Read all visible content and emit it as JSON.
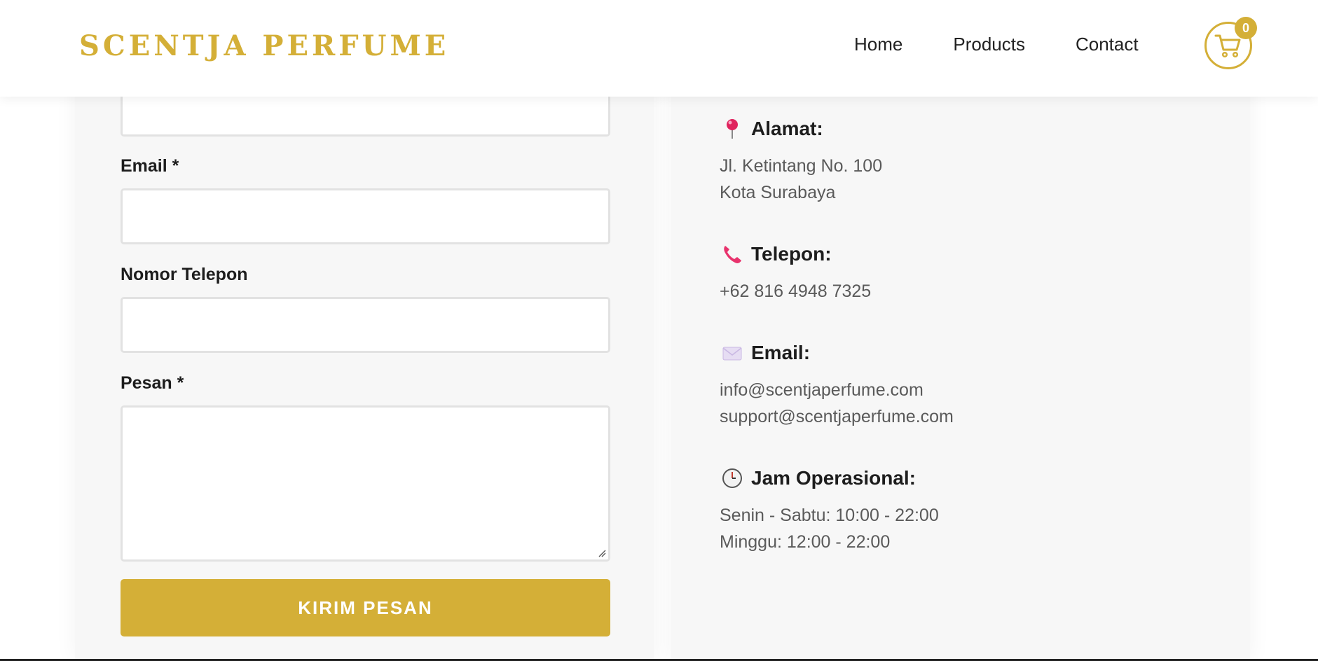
{
  "header": {
    "logo": "SCENTJA PERFUME",
    "nav": [
      "Home",
      "Products",
      "Contact"
    ],
    "cart_count": "0"
  },
  "form": {
    "email_label": "Email *",
    "phone_label": "Nomor Telepon",
    "message_label": "Pesan *",
    "submit_label": "KIRIM PESAN"
  },
  "info": {
    "address_heading": "Alamat:",
    "address_lines": [
      "Jl. Ketintang No. 100",
      "Kota Surabaya"
    ],
    "phone_heading": "Telepon:",
    "phone_lines": [
      "+62 816 4948 7325"
    ],
    "email_heading": "Email:",
    "email_lines": [
      "info@scentjaperfume.com",
      "support@scentjaperfume.com"
    ],
    "hours_heading": "Jam Operasional:",
    "hours_lines": [
      "Senin - Sabtu: 10:00 - 22:00",
      "Minggu: 12:00 - 22:00"
    ]
  },
  "colors": {
    "accent": "#d4af37",
    "panel_bg": "#f7f7f7",
    "text_dark": "#1d1d1d",
    "text_muted": "#5a5a5a"
  },
  "icons": {
    "address": "pin-icon",
    "phone": "phone-icon",
    "email": "envelope-icon",
    "hours": "clock-icon",
    "cart": "cart-icon"
  }
}
